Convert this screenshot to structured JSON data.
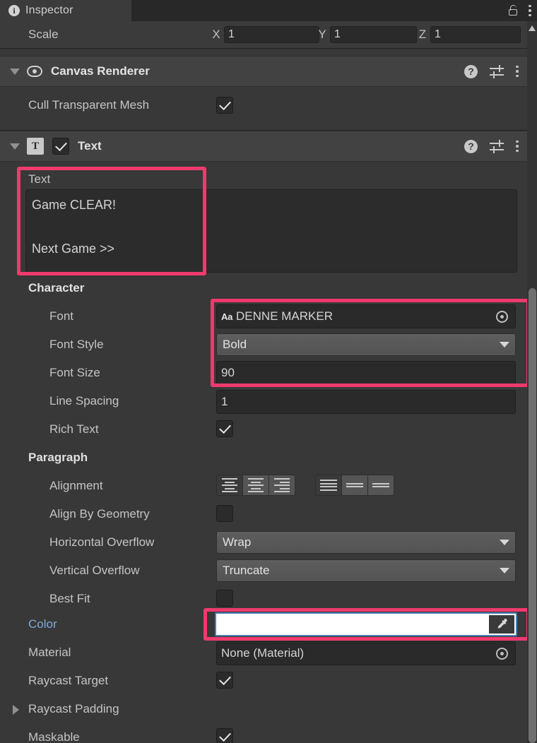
{
  "window": {
    "tab_label": "Inspector",
    "info_icon": "info-icon",
    "lock_icon": "lock-open-icon",
    "menu_icon": "kebab-menu-icon"
  },
  "colors": {
    "highlight": "#ef3a6e",
    "panel": "#383838",
    "header": "#424242",
    "field": "#2a2a2a",
    "label": "#c4c4c4",
    "label_blue": "#7ea9d8",
    "swatch": "#ffffff"
  },
  "transform": {
    "scale_label": "Scale",
    "axes": [
      {
        "axis": "X",
        "value": "1"
      },
      {
        "axis": "Y",
        "value": "1"
      },
      {
        "axis": "Z",
        "value": "1"
      }
    ]
  },
  "canvas_renderer": {
    "title": "Canvas Renderer",
    "foldout": "expanded",
    "icon": "eye-icon",
    "help_icon": "help-icon",
    "preset_icon": "preset-settings-icon",
    "menu_icon": "kebab-menu-icon",
    "cull_transparent_mesh": {
      "label": "Cull Transparent Mesh",
      "checked": true
    }
  },
  "text_component": {
    "title": "Text",
    "icon": "text-component-icon",
    "enabled": true,
    "foldout": "expanded",
    "help_icon": "help-icon",
    "preset_icon": "preset-settings-icon",
    "menu_icon": "kebab-menu-icon",
    "text_field": {
      "label": "Text",
      "value": "Game CLEAR!\n\nNext Game >>"
    },
    "character": {
      "section_title": "Character",
      "font": {
        "label": "Font",
        "value": "DENNE MARKER",
        "icon": "font-asset-icon",
        "picker": "object-picker-icon"
      },
      "font_style": {
        "label": "Font Style",
        "value": "Bold"
      },
      "font_size": {
        "label": "Font Size",
        "value": "90"
      },
      "line_spacing": {
        "label": "Line Spacing",
        "value": "1"
      },
      "rich_text": {
        "label": "Rich Text",
        "checked": true
      }
    },
    "paragraph": {
      "section_title": "Paragraph",
      "alignment": {
        "label": "Alignment",
        "horizontal_options": [
          "align-left",
          "align-center",
          "align-right"
        ],
        "horizontal_selected": 0,
        "vertical_options": [
          "align-top",
          "align-middle",
          "align-bottom"
        ],
        "vertical_selected": 0
      },
      "align_by_geometry": {
        "label": "Align By Geometry",
        "checked": false
      },
      "horizontal_overflow": {
        "label": "Horizontal Overflow",
        "value": "Wrap"
      },
      "vertical_overflow": {
        "label": "Vertical Overflow",
        "value": "Truncate"
      },
      "best_fit": {
        "label": "Best Fit",
        "checked": false
      }
    },
    "color": {
      "label": "Color",
      "value": "#FFFFFF",
      "eyedropper_icon": "eyedropper-icon"
    },
    "material": {
      "label": "Material",
      "value": "None (Material)",
      "picker": "object-picker-icon"
    },
    "raycast_target": {
      "label": "Raycast Target",
      "checked": true
    },
    "raycast_padding": {
      "label": "Raycast Padding",
      "foldout": "collapsed"
    },
    "maskable": {
      "label": "Maskable",
      "checked": true
    }
  },
  "scrollbar": {
    "up_arrow": "scroll-up-arrow-icon"
  }
}
